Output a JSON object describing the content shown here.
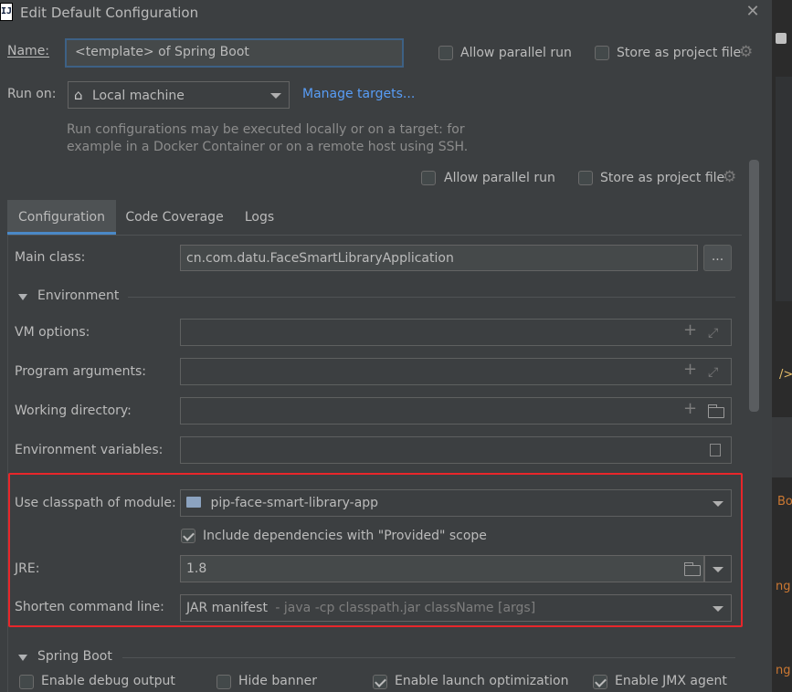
{
  "window": {
    "title": "Edit Default Configuration",
    "app_icon_text": "IJ"
  },
  "header": {
    "name_label": "Name:",
    "name_value": "<template> of Spring Boot",
    "allow_parallel_run": {
      "label": "Allow parallel run",
      "checked": false
    },
    "store_as_project_file": {
      "label": "Store as project file",
      "checked": false
    }
  },
  "run_on": {
    "label": "Run on:",
    "selected": "Local machine",
    "manage_link": "Manage targets...",
    "hint_line1": "Run configurations may be executed locally or on a target: for",
    "hint_line2": "example in a Docker Container or on a remote host using SSH."
  },
  "options_row2": {
    "allow_parallel_run": {
      "label": "Allow parallel run",
      "checked": false
    },
    "store_as_project_file": {
      "label": "Store as project file",
      "checked": false
    }
  },
  "tabs": [
    {
      "label": "Configuration",
      "active": true
    },
    {
      "label": "Code Coverage",
      "active": false
    },
    {
      "label": "Logs",
      "active": false
    }
  ],
  "config": {
    "main_class_label": "Main class:",
    "main_class_value": "cn.com.datu.FaceSmartLibraryApplication",
    "browse_button": "...",
    "environment_section": "Environment",
    "vm_options_label": "VM options:",
    "program_arguments_label": "Program arguments:",
    "working_directory_label": "Working directory:",
    "environment_variables_label": "Environment variables:",
    "classpath_label": "Use classpath of module:",
    "classpath_value": "pip-face-smart-library-app",
    "include_deps": {
      "label": "Include dependencies with \"Provided\" scope",
      "checked": true
    },
    "jre_label": "JRE:",
    "jre_value": "1.8",
    "shorten_label": "Shorten command line:",
    "shorten_value": "JAR manifest",
    "shorten_hint": "- java -cp classpath.jar className [args]",
    "spring_boot_section": "Spring Boot",
    "spring_boot_options": [
      {
        "label": "Enable debug output",
        "checked": false
      },
      {
        "label": "Hide banner",
        "checked": false
      },
      {
        "label": "Enable launch optimization",
        "checked": true
      },
      {
        "label": "Enable JMX agent",
        "checked": true
      }
    ]
  },
  "editor_strip": {
    "text_tag": "/>",
    "text_bo": "Bo",
    "text_ng1": "ng",
    "text_ng2": "ng"
  },
  "colors": {
    "background": "#3c3f41",
    "link": "#589df6",
    "highlight_border": "#e8262a",
    "tab_underline": "#4a88c7"
  }
}
